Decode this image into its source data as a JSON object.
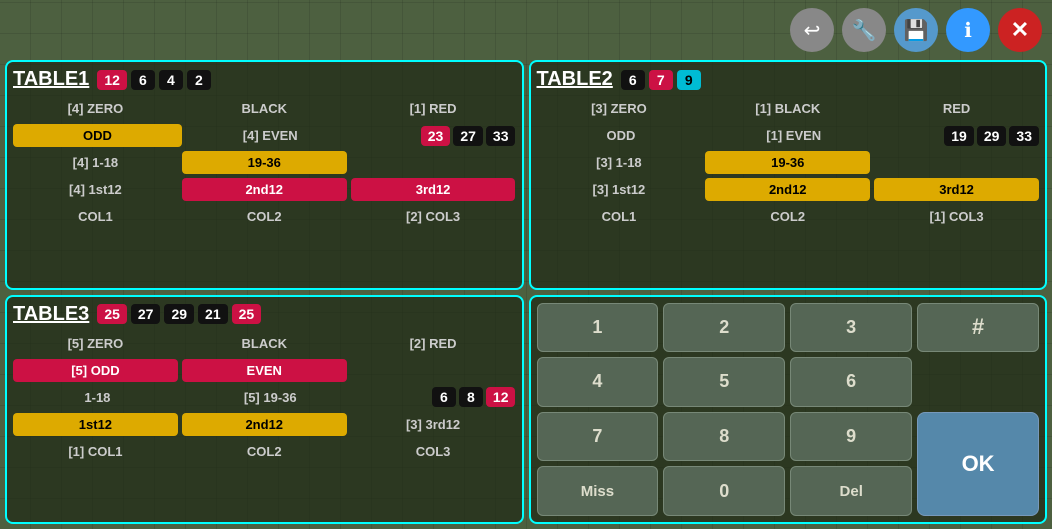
{
  "toolbar": {
    "back_label": "↩",
    "wrench_label": "🔧",
    "save_label": "💾",
    "info_label": "ℹ",
    "close_label": "✕"
  },
  "table1": {
    "title": "TABLE1",
    "header_badges": [
      {
        "value": "12",
        "color": "red"
      },
      {
        "value": "6",
        "color": "black"
      },
      {
        "value": "4",
        "color": "black"
      },
      {
        "value": "2",
        "color": "black"
      }
    ],
    "rows": [
      {
        "cols": [
          "[4] ZERO",
          "BLACK",
          "[1] RED"
        ]
      },
      {
        "cols": [
          "ODD",
          "[4] EVEN",
          "23  27  33"
        ]
      },
      {
        "cols": [
          "[4] 1-18",
          "19-36",
          ""
        ]
      },
      {
        "cols": [
          "[4] 1st12",
          "2nd12",
          "3rd12"
        ]
      },
      {
        "cols": [
          "COL1",
          "COL2",
          "[2] COL3"
        ]
      }
    ]
  },
  "table2": {
    "title": "TABLE2",
    "header_badges": [
      {
        "value": "6",
        "color": "black"
      },
      {
        "value": "7",
        "color": "red"
      },
      {
        "value": "9",
        "color": "cyan"
      }
    ],
    "rows": [
      {
        "cols": [
          "[3] ZERO",
          "[1] BLACK",
          "RED"
        ]
      },
      {
        "cols": [
          "ODD",
          "[1] EVEN",
          "19  29  33"
        ]
      },
      {
        "cols": [
          "[3] 1-18",
          "19-36",
          ""
        ]
      },
      {
        "cols": [
          "[3] 1st12",
          "2nd12",
          "3rd12"
        ]
      },
      {
        "cols": [
          "COL1",
          "COL2",
          "[1] COL3"
        ]
      }
    ]
  },
  "table3": {
    "title": "TABLE3",
    "header_badges": [
      {
        "value": "25",
        "color": "red"
      },
      {
        "value": "27",
        "color": "black"
      },
      {
        "value": "29",
        "color": "black"
      },
      {
        "value": "21",
        "color": "black"
      },
      {
        "value": "25",
        "color": "red"
      }
    ],
    "rows": [
      {
        "cols": [
          "[5] ZERO",
          "BLACK",
          "[2] RED"
        ]
      },
      {
        "cols": [
          "[5] ODD",
          "EVEN",
          ""
        ]
      },
      {
        "cols": [
          "1-18",
          "[5] 19-36",
          "6  8  12"
        ]
      },
      {
        "cols": [
          "1st12",
          "2nd12",
          "[3] 3rd12"
        ]
      },
      {
        "cols": [
          "[1] COL1",
          "COL2",
          "COL3"
        ]
      }
    ]
  },
  "numpad": {
    "buttons": [
      "1",
      "2",
      "3",
      "4",
      "5",
      "6",
      "7",
      "8",
      "9",
      "Miss",
      "0",
      "Del"
    ],
    "hash": "#",
    "ok": "OK"
  }
}
